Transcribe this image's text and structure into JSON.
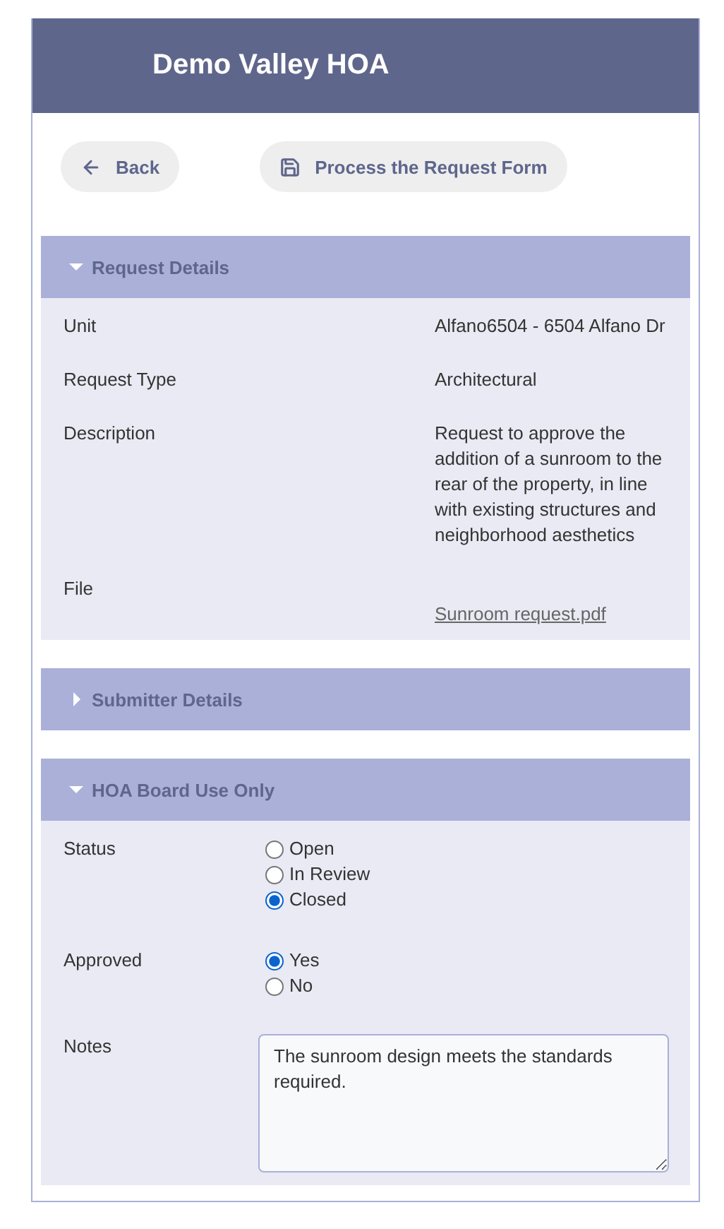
{
  "header": {
    "title": "Demo Valley HOA"
  },
  "buttons": [
    {
      "label": "Back",
      "kind": "back"
    },
    {
      "label": "Process the Request Form",
      "kind": "save"
    }
  ],
  "sections": [
    {
      "title": "Request Details",
      "expanded": true,
      "kind": "details",
      "rows": [
        {
          "label": "Unit",
          "value": "Alfano6504 - 6504 Alfano Dr"
        },
        {
          "label": "Request Type",
          "value": "Architectural"
        },
        {
          "label": "Description",
          "value": "Request to approve the addition of a sunroom to the rear of the property, in line with existing structures and neighborhood aesthetics"
        },
        {
          "label": "File",
          "link": "Sunroom request.pdf"
        }
      ]
    },
    {
      "title": "Submitter Details",
      "expanded": false
    },
    {
      "title": "HOA Board Use Only",
      "expanded": true,
      "kind": "board",
      "fields": [
        {
          "label": "Status",
          "kind": "radio",
          "options": [
            {
              "label": "Open",
              "selected": false
            },
            {
              "label": "In Review",
              "selected": false
            },
            {
              "label": "Closed",
              "selected": true
            }
          ]
        },
        {
          "label": "Approved",
          "kind": "radio",
          "options": [
            {
              "label": "Yes",
              "selected": true
            },
            {
              "label": "No",
              "selected": false
            }
          ]
        },
        {
          "label": "Notes",
          "kind": "textarea",
          "value": "The sunroom design meets the standards required."
        }
      ]
    }
  ]
}
